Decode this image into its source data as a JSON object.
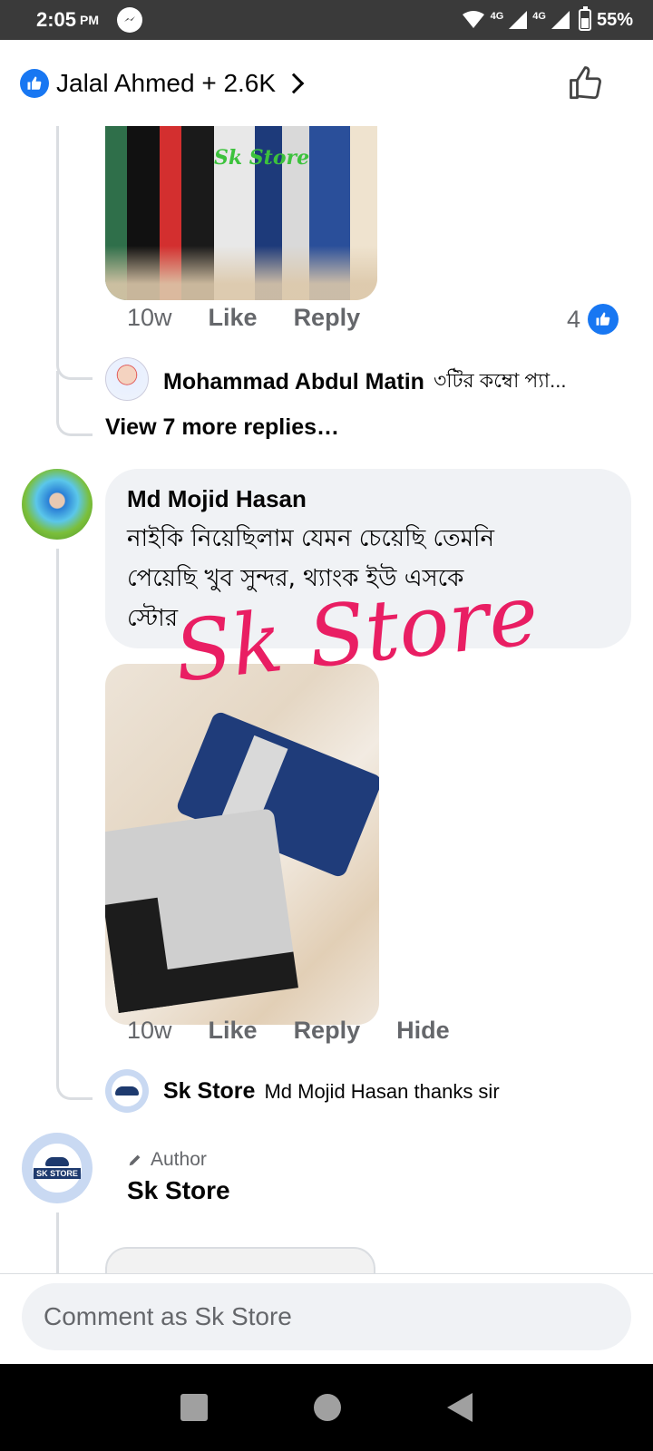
{
  "status_bar": {
    "time": "2:05",
    "ampm": "PM",
    "network_1": "4G",
    "network_2": "4G",
    "battery": "55%",
    "battery_level_percent": 55
  },
  "header": {
    "title": "Jalal Ahmed + 2.6K"
  },
  "comment_1": {
    "photo_watermark": "Sk Store",
    "time": "10w",
    "like_label": "Like",
    "reply_label": "Reply",
    "reaction_count": "4",
    "reply": {
      "name": "Mohammad Abdul Matin",
      "text": "৩টির কম্বো প্যা..."
    },
    "view_more": "View 7 more replies…"
  },
  "comment_2": {
    "name": "Md Mojid Hasan",
    "text_line_1": "নাইকি নিয়েছিলাম যেমন চেয়েছি তেমনি",
    "text_line_2": "পেয়েছি খুব সুন্দর, থ্যাংক ইউ এসকে",
    "text_line_3": "স্টোর",
    "watermark": "Sk Store",
    "time": "10w",
    "like_label": "Like",
    "reply_label": "Reply",
    "hide_label": "Hide",
    "reply": {
      "name": "Sk Store",
      "text": "Md Mojid Hasan thanks sir"
    }
  },
  "comment_3": {
    "author_tag": "Author",
    "name": "Sk Store"
  },
  "store_avatar_text": "SK STORE",
  "comment_bar": {
    "placeholder": "Comment as Sk Store"
  },
  "colors": {
    "facebook_blue": "#1877f2",
    "bubble_bg": "#f0f2f5",
    "secondary_text": "#65676b",
    "watermark_pink": "#e91e63"
  }
}
